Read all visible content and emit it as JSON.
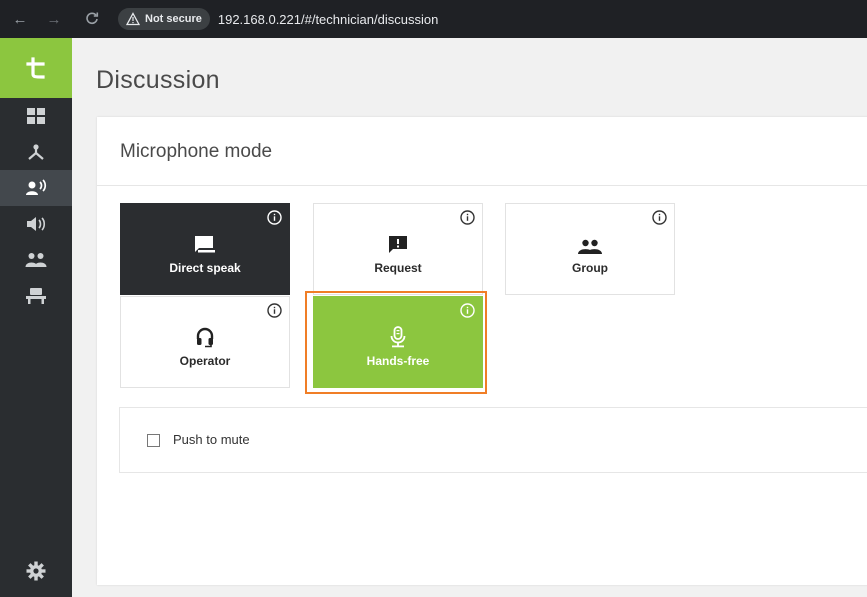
{
  "browser": {
    "back_icon": "←",
    "forward_icon": "→",
    "reload_icon": "C",
    "security_label": "Not secure",
    "url": "192.168.0.221/#/technician/discussion"
  },
  "sidebar": {
    "logo_text": "t",
    "items": [
      {
        "icon": "dashboard-icon",
        "active": false
      },
      {
        "icon": "network-icon",
        "active": false
      },
      {
        "icon": "speaker-person-icon",
        "active": true
      },
      {
        "icon": "volume-icon",
        "active": false
      },
      {
        "icon": "people-icon",
        "active": false
      },
      {
        "icon": "seats-icon",
        "active": false
      }
    ],
    "settings_icon": "gear-icon",
    "accent": "#8cc63f"
  },
  "page": {
    "title": "Discussion",
    "section_title": "Microphone mode",
    "modes": [
      {
        "label": "Direct speak",
        "icon": "chat-bubble-icon",
        "state": "dark"
      },
      {
        "label": "Request",
        "icon": "request-icon",
        "state": "normal"
      },
      {
        "label": "Group",
        "icon": "group-icon",
        "state": "normal"
      },
      {
        "label": "Operator",
        "icon": "headset-icon",
        "state": "normal"
      },
      {
        "label": "Hands-free",
        "icon": "microphone-icon",
        "state": "selected"
      }
    ],
    "push_to_mute_label": "Push to mute",
    "push_to_mute_checked": false
  },
  "colors": {
    "selected": "#8cc63f",
    "dark_tile": "#2b2d30",
    "highlight_border": "#f07e26"
  }
}
